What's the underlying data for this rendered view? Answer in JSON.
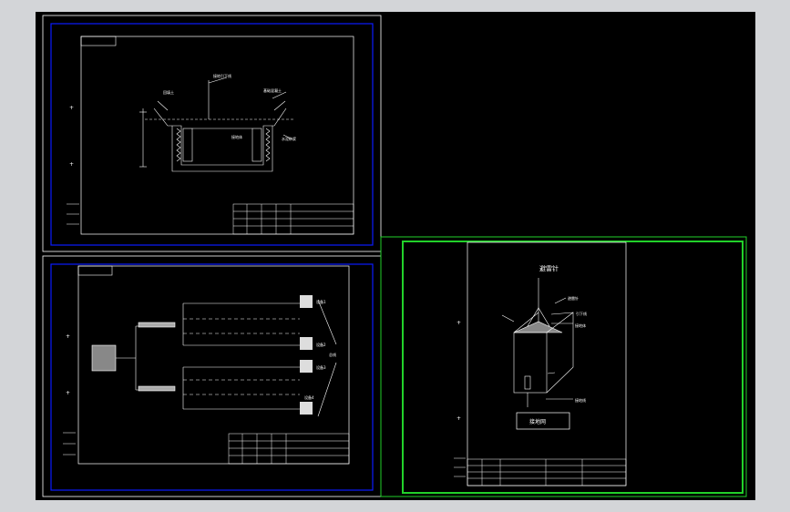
{
  "app": {
    "title": "",
    "canvas_background": "#000000",
    "workspace_background": "#d3d5d8"
  },
  "colors": {
    "sheet_border": "#ffffff",
    "viewport_blue": "#0b1cff",
    "viewport_green": "#22d12a",
    "lines": "#ffffff"
  },
  "sheets": {
    "foundation": {
      "labels": {
        "l1": "接地引下线",
        "l2": "回填土",
        "l3": "基础混凝土",
        "l4": "接地体",
        "l5": "水泥砂浆"
      }
    },
    "system": {
      "labels": {
        "d1": "设备1",
        "d2": "设备2",
        "d3": "设备3",
        "d4": "设备4",
        "bus": "总线"
      }
    },
    "lightning": {
      "title": "避雷针",
      "labels": {
        "a": "避雷针",
        "b": "引下线",
        "c": "接地体",
        "d": "接地线"
      },
      "box_label": "接地网"
    }
  },
  "cursor_crosshairs": "+"
}
